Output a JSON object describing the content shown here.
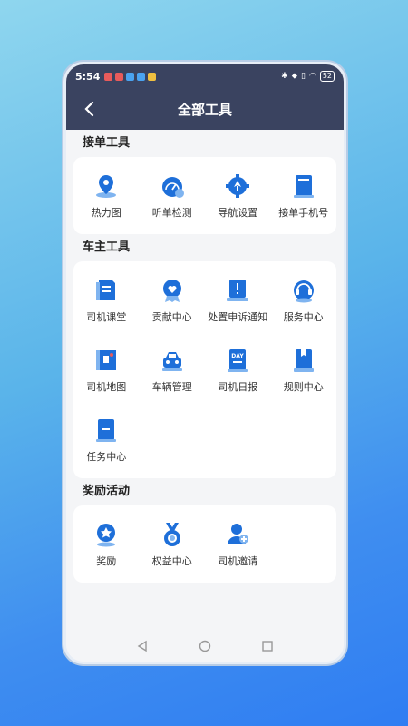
{
  "status_bar": {
    "time": "5:54",
    "battery": "52"
  },
  "header": {
    "title": "全部工具"
  },
  "sections": [
    {
      "title": "接单工具",
      "items": [
        {
          "label": "热力图",
          "icon": "map-pin-icon"
        },
        {
          "label": "听单检测",
          "icon": "gauge-icon"
        },
        {
          "label": "导航设置",
          "icon": "navigation-gear-icon"
        },
        {
          "label": "接单手机号",
          "icon": "phone-book-icon"
        }
      ]
    },
    {
      "title": "车主工具",
      "items": [
        {
          "label": "司机课堂",
          "icon": "course-book-icon"
        },
        {
          "label": "贡献中心",
          "icon": "heart-medal-icon"
        },
        {
          "label": "处置申诉通知",
          "icon": "alert-notice-icon"
        },
        {
          "label": "服务中心",
          "icon": "headset-icon"
        },
        {
          "label": "司机地图",
          "icon": "map-icon"
        },
        {
          "label": "车辆管理",
          "icon": "car-icon"
        },
        {
          "label": "司机日报",
          "icon": "daily-report-icon"
        },
        {
          "label": "规则中心",
          "icon": "rules-book-icon"
        },
        {
          "label": "任务中心",
          "icon": "task-icon"
        }
      ]
    },
    {
      "title": "奖励活动",
      "items": [
        {
          "label": "奖励",
          "icon": "star-badge-icon"
        },
        {
          "label": "权益中心",
          "icon": "medal-icon"
        },
        {
          "label": "司机邀请",
          "icon": "invite-user-icon"
        }
      ]
    }
  ],
  "colors": {
    "header": "#3a4360",
    "icon_primary": "#1e6fd9",
    "icon_light": "#7fb4f0"
  }
}
